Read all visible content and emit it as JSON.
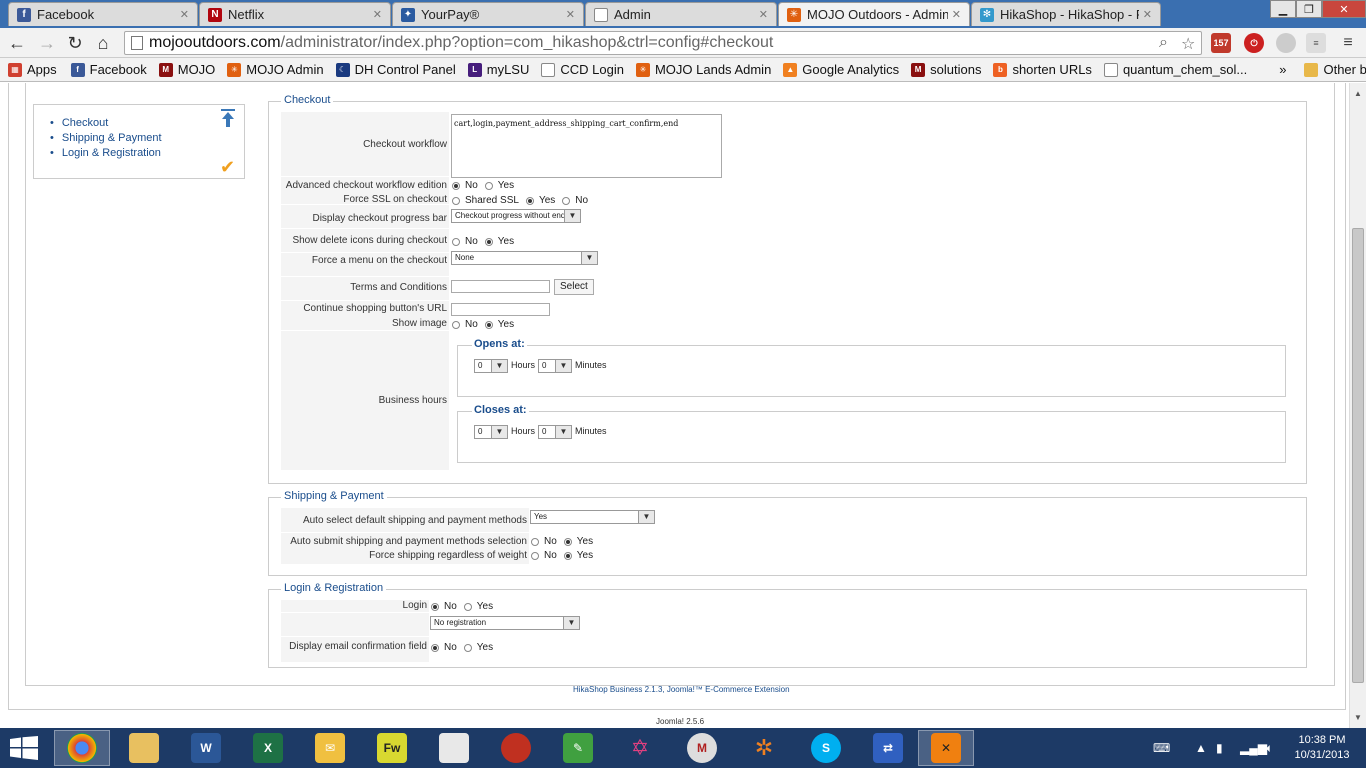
{
  "tabs": [
    {
      "title": "Facebook",
      "icon": "facebook-icon",
      "color": "#3b5998",
      "glyph": "f"
    },
    {
      "title": "Netflix",
      "icon": "netflix-icon",
      "color": "#b1060f",
      "glyph": "N"
    },
    {
      "title": "YourPay®",
      "icon": "yourpay-icon",
      "color": "#2a5aa0",
      "glyph": "✦"
    },
    {
      "title": "Admin",
      "icon": "page-icon",
      "color": "#ffffff",
      "glyph": ""
    },
    {
      "title": "MOJO Outdoors - Admini",
      "icon": "joomla-icon",
      "color": "#e06010",
      "glyph": "✳"
    },
    {
      "title": "HikaShop - HikaShop - Re",
      "icon": "hikashop-icon",
      "color": "#3399cc",
      "glyph": "✻"
    }
  ],
  "address": {
    "host": "mojooutdoors.com",
    "path": "/administrator/index.php?option=com_hikashop&ctrl=config#checkout"
  },
  "extensions": {
    "gmail_count": "157"
  },
  "bookmarks": [
    {
      "label": "Apps",
      "icon": "apps-icon",
      "color": "#d04030"
    },
    {
      "label": "Facebook",
      "icon": "facebook-icon",
      "color": "#3b5998"
    },
    {
      "label": "MOJO",
      "icon": "mojo-icon",
      "color": "#8a1010"
    },
    {
      "label": "MOJO Admin",
      "icon": "joomla-icon",
      "color": "#e06010"
    },
    {
      "label": "DH Control Panel",
      "icon": "moon-icon",
      "color": "#1a3a80"
    },
    {
      "label": "myLSU",
      "icon": "lsu-icon",
      "color": "#461d7c"
    },
    {
      "label": "CCD Login",
      "icon": "page-icon",
      "color": "#ffffff"
    },
    {
      "label": "MOJO Lands Admin",
      "icon": "joomla-icon",
      "color": "#e06010"
    },
    {
      "label": "Google Analytics",
      "icon": "analytics-icon",
      "color": "#f08020"
    },
    {
      "label": "solutions",
      "icon": "mit-icon",
      "color": "#8a1010"
    },
    {
      "label": "shorten URLs",
      "icon": "bitly-icon",
      "color": "#ee6123"
    },
    {
      "label": "quantum_chem_sol...",
      "icon": "page-icon",
      "color": "#ffffff"
    },
    {
      "label": "»",
      "icon": "more-icon",
      "color": ""
    },
    {
      "label": "Other bookmarks",
      "icon": "folder-icon",
      "color": "#e8b84a"
    }
  ],
  "sidebar": {
    "items": [
      "Checkout",
      "Shipping & Payment",
      "Login & Registration"
    ]
  },
  "checkout": {
    "legend": "Checkout",
    "workflow_label": "Checkout workflow",
    "workflow_value": "cart,login,payment_address_shipping_cart_confirm,end",
    "advanced_label": "Advanced checkout workflow edition",
    "force_ssl_label": "Force SSL on checkout",
    "progress_label": "Display checkout progress bar",
    "progress_value": "Checkout progress without end",
    "delete_icons_label": "Show delete icons during checkout",
    "force_menu_label": "Force a menu on the checkout",
    "force_menu_value": "None",
    "terms_label": "Terms and Conditions",
    "select_button": "Select",
    "continue_url_label": "Continue shopping button's URL",
    "show_image_label": "Show image",
    "business_hours_label": "Business hours",
    "opens_at": "Opens at:",
    "closes_at": "Closes at:",
    "hours": "Hours",
    "minutes": "Minutes",
    "zero": "0"
  },
  "options": {
    "no": "No",
    "yes": "Yes",
    "shared_ssl": "Shared SSL"
  },
  "shipping": {
    "legend": "Shipping & Payment",
    "auto_select_label": "Auto select default shipping and payment methods",
    "auto_select_value": "Yes",
    "auto_submit_label": "Auto submit shipping and payment methods selection",
    "force_shipping_label": "Force shipping regardless of weight"
  },
  "login": {
    "legend": "Login & Registration",
    "login_label": "Login",
    "registration_value": "No registration",
    "email_confirm_label": "Display email confirmation field"
  },
  "footer": {
    "credit": "HikaShop Business 2.1.3, Joomla!™ E-Commerce Extension",
    "version": "Joomla! 2.5.6"
  },
  "taskbar": {
    "time": "10:38 PM",
    "date": "10/31/2013"
  }
}
